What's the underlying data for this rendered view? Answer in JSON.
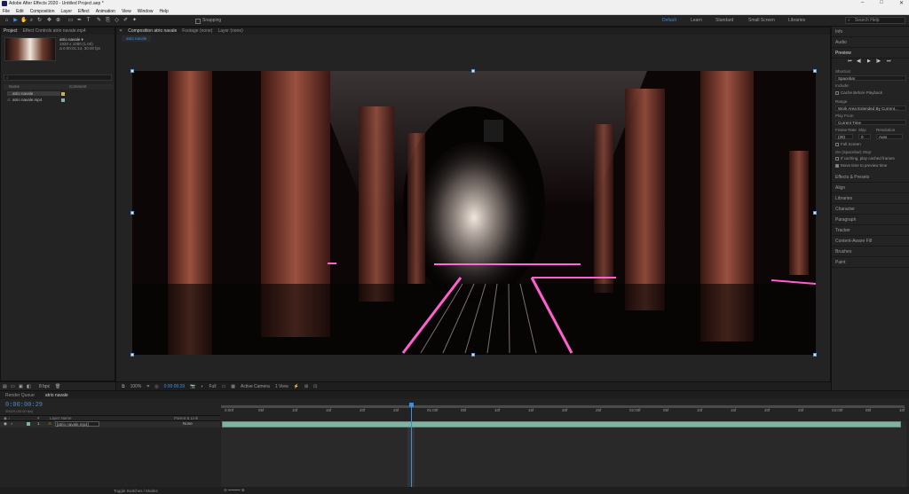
{
  "window": {
    "title": "Adobe After Effects 2020 - Untitled Project.aep *"
  },
  "menu": [
    "File",
    "Edit",
    "Composition",
    "Layer",
    "Effect",
    "Animation",
    "View",
    "Window",
    "Help"
  ],
  "toolbar": {
    "snapping_label": "Snapping",
    "workspaces": [
      "Default",
      "Learn",
      "Standard",
      "Small Screen",
      "Libraries"
    ],
    "active_workspace": "Default",
    "search_placeholder": "Search Help"
  },
  "project_panel": {
    "tabs": [
      "Project",
      "Effect Controls atrio navale.mp4"
    ],
    "item_name": "atrio navale ▾",
    "item_info_1": "1920 x 1080 (1.00)",
    "item_info_2": "Δ 0:00:01:14, 30.00 fps",
    "columns": [
      "Name",
      "Comment"
    ],
    "items": [
      {
        "name": "atrio navale",
        "type": "composition",
        "selected": true
      },
      {
        "name": "atrio navale.mp4",
        "type": "footage",
        "selected": false
      }
    ],
    "footer_bpc": "8 bpc"
  },
  "comp_panel": {
    "tabs": [
      "Composition atrio navale",
      "Footage (none)",
      "Layer (none)"
    ],
    "sub_tab": "atrio navale",
    "footer": {
      "zoom": "100%",
      "timecode": "0:00:00:29",
      "resolution": "Full",
      "camera": "Active Camera",
      "views": "1 View"
    }
  },
  "right_panel": {
    "sections_top": [
      "Info",
      "Audio",
      "Preview"
    ],
    "shortcut_label": "Shortcut",
    "shortcut_value": "Spacebar",
    "include_label": "Include:",
    "cache_label": "Cache Before Playback",
    "range_label": "Range",
    "range_value": "Work Area Extended By Current...",
    "play_from_label": "Play From",
    "play_from_value": "Current Time",
    "frame_rate_label": "Frame Rate",
    "skip_label": "Skip",
    "resolution_label": "Resolution",
    "frame_rate_value": "(30)",
    "skip_value": "0",
    "resolution_value": "Auto",
    "full_screen_label": "Full Screen",
    "on_stop_label": "On (Spacebar) Stop:",
    "if_caching_label": "If caching, play cached frames",
    "move_time_label": "Move time to preview time",
    "sections_bottom": [
      "Effects & Presets",
      "Align",
      "Libraries",
      "Character",
      "Paragraph",
      "Tracker",
      "Content-Aware Fill",
      "Brushes",
      "Paint"
    ]
  },
  "timeline": {
    "tabs": [
      "Render Queue",
      "atrio navale"
    ],
    "timecode": "0:00:00:29",
    "timecode_sub": "00029 (30.00 fps)",
    "columns": [
      "#",
      "Layer Name",
      "Parent & Link"
    ],
    "layer": {
      "index": "1",
      "name": "[atrio navale.mp4]",
      "parent": "None"
    },
    "ruler_ticks": [
      "0:00f",
      "05f",
      "10f",
      "15f",
      "20f",
      "25f",
      "01:00f",
      "05f",
      "10f",
      "15f",
      "20f",
      "25f",
      "02:00f",
      "05f",
      "10f",
      "15f",
      "20f",
      "25f",
      "03:00f",
      "05f",
      "10f"
    ],
    "playhead_fraction": 0.278,
    "footer": "Toggle Switches / Modes"
  }
}
